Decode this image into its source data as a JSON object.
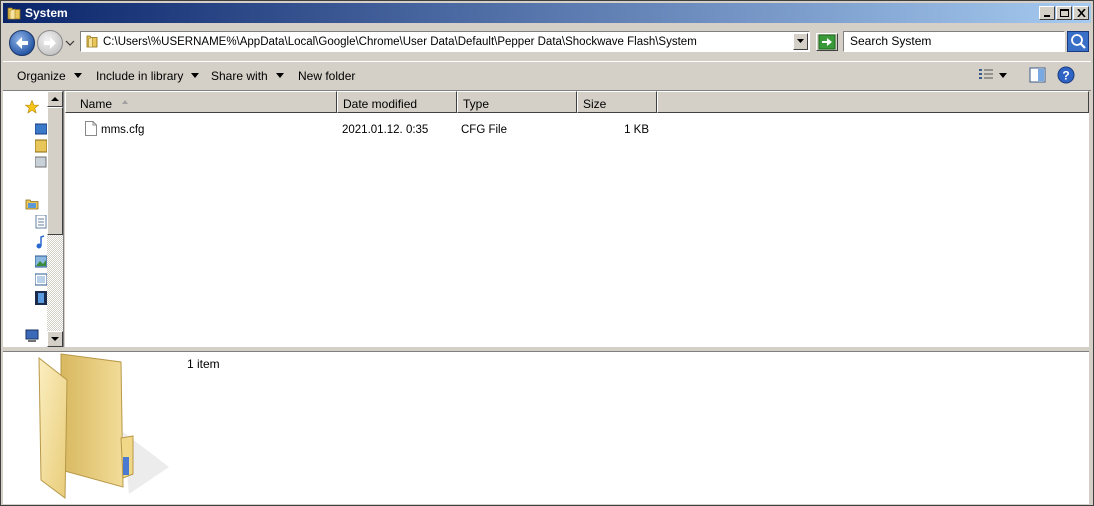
{
  "window": {
    "title": "System"
  },
  "address_bar": {
    "path": "C:\\Users\\%USERNAME%\\AppData\\Local\\Google\\Chrome\\User Data\\Default\\Pepper Data\\Shockwave Flash\\System"
  },
  "search": {
    "placeholder": "Search System"
  },
  "toolbar": {
    "organize": "Organize",
    "include_in_library": "Include in library",
    "share_with": "Share with",
    "new_folder": "New folder"
  },
  "columns": {
    "name": "Name",
    "date_modified": "Date modified",
    "type": "Type",
    "size": "Size"
  },
  "files": [
    {
      "name": "mms.cfg",
      "date_modified": "2021.01.12. 0:35",
      "type": "CFG File",
      "size": "1 KB"
    }
  ],
  "details_pane": {
    "item_count": "1 item"
  },
  "colors": {
    "titlebar_start": "#0a246a",
    "titlebar_end": "#a6caf0",
    "window_face": "#d4d0c8"
  }
}
